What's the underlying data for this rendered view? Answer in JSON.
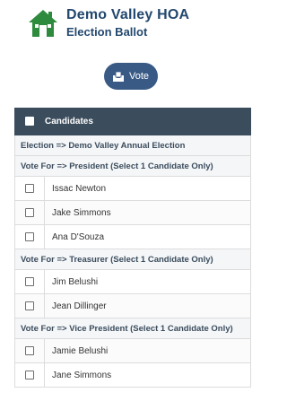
{
  "header": {
    "org_name": "Demo Valley HOA",
    "subtitle": "Election Ballot",
    "logo_icon": "house-icon",
    "brand_color": "#23486e"
  },
  "vote_button": {
    "label": "Vote",
    "icon": "ballot-box-icon",
    "color": "#3a5a86"
  },
  "table": {
    "header": "Candidates",
    "header_color": "#3b4c5d",
    "election_row": "Election => Demo Valley Annual Election",
    "groups": [
      {
        "title": "Vote For => President (Select 1 Candidate Only)",
        "candidates": [
          "Issac Newton",
          "Jake Simmons",
          "Ana D'Souza"
        ]
      },
      {
        "title": "Vote For => Treasurer (Select 1 Candidate Only)",
        "candidates": [
          "Jim Belushi",
          "Jean Dillinger"
        ]
      },
      {
        "title": "Vote For => Vice President (Select 1 Candidate Only)",
        "candidates": [
          "Jamie Belushi",
          "Jane Simmons"
        ]
      }
    ]
  }
}
